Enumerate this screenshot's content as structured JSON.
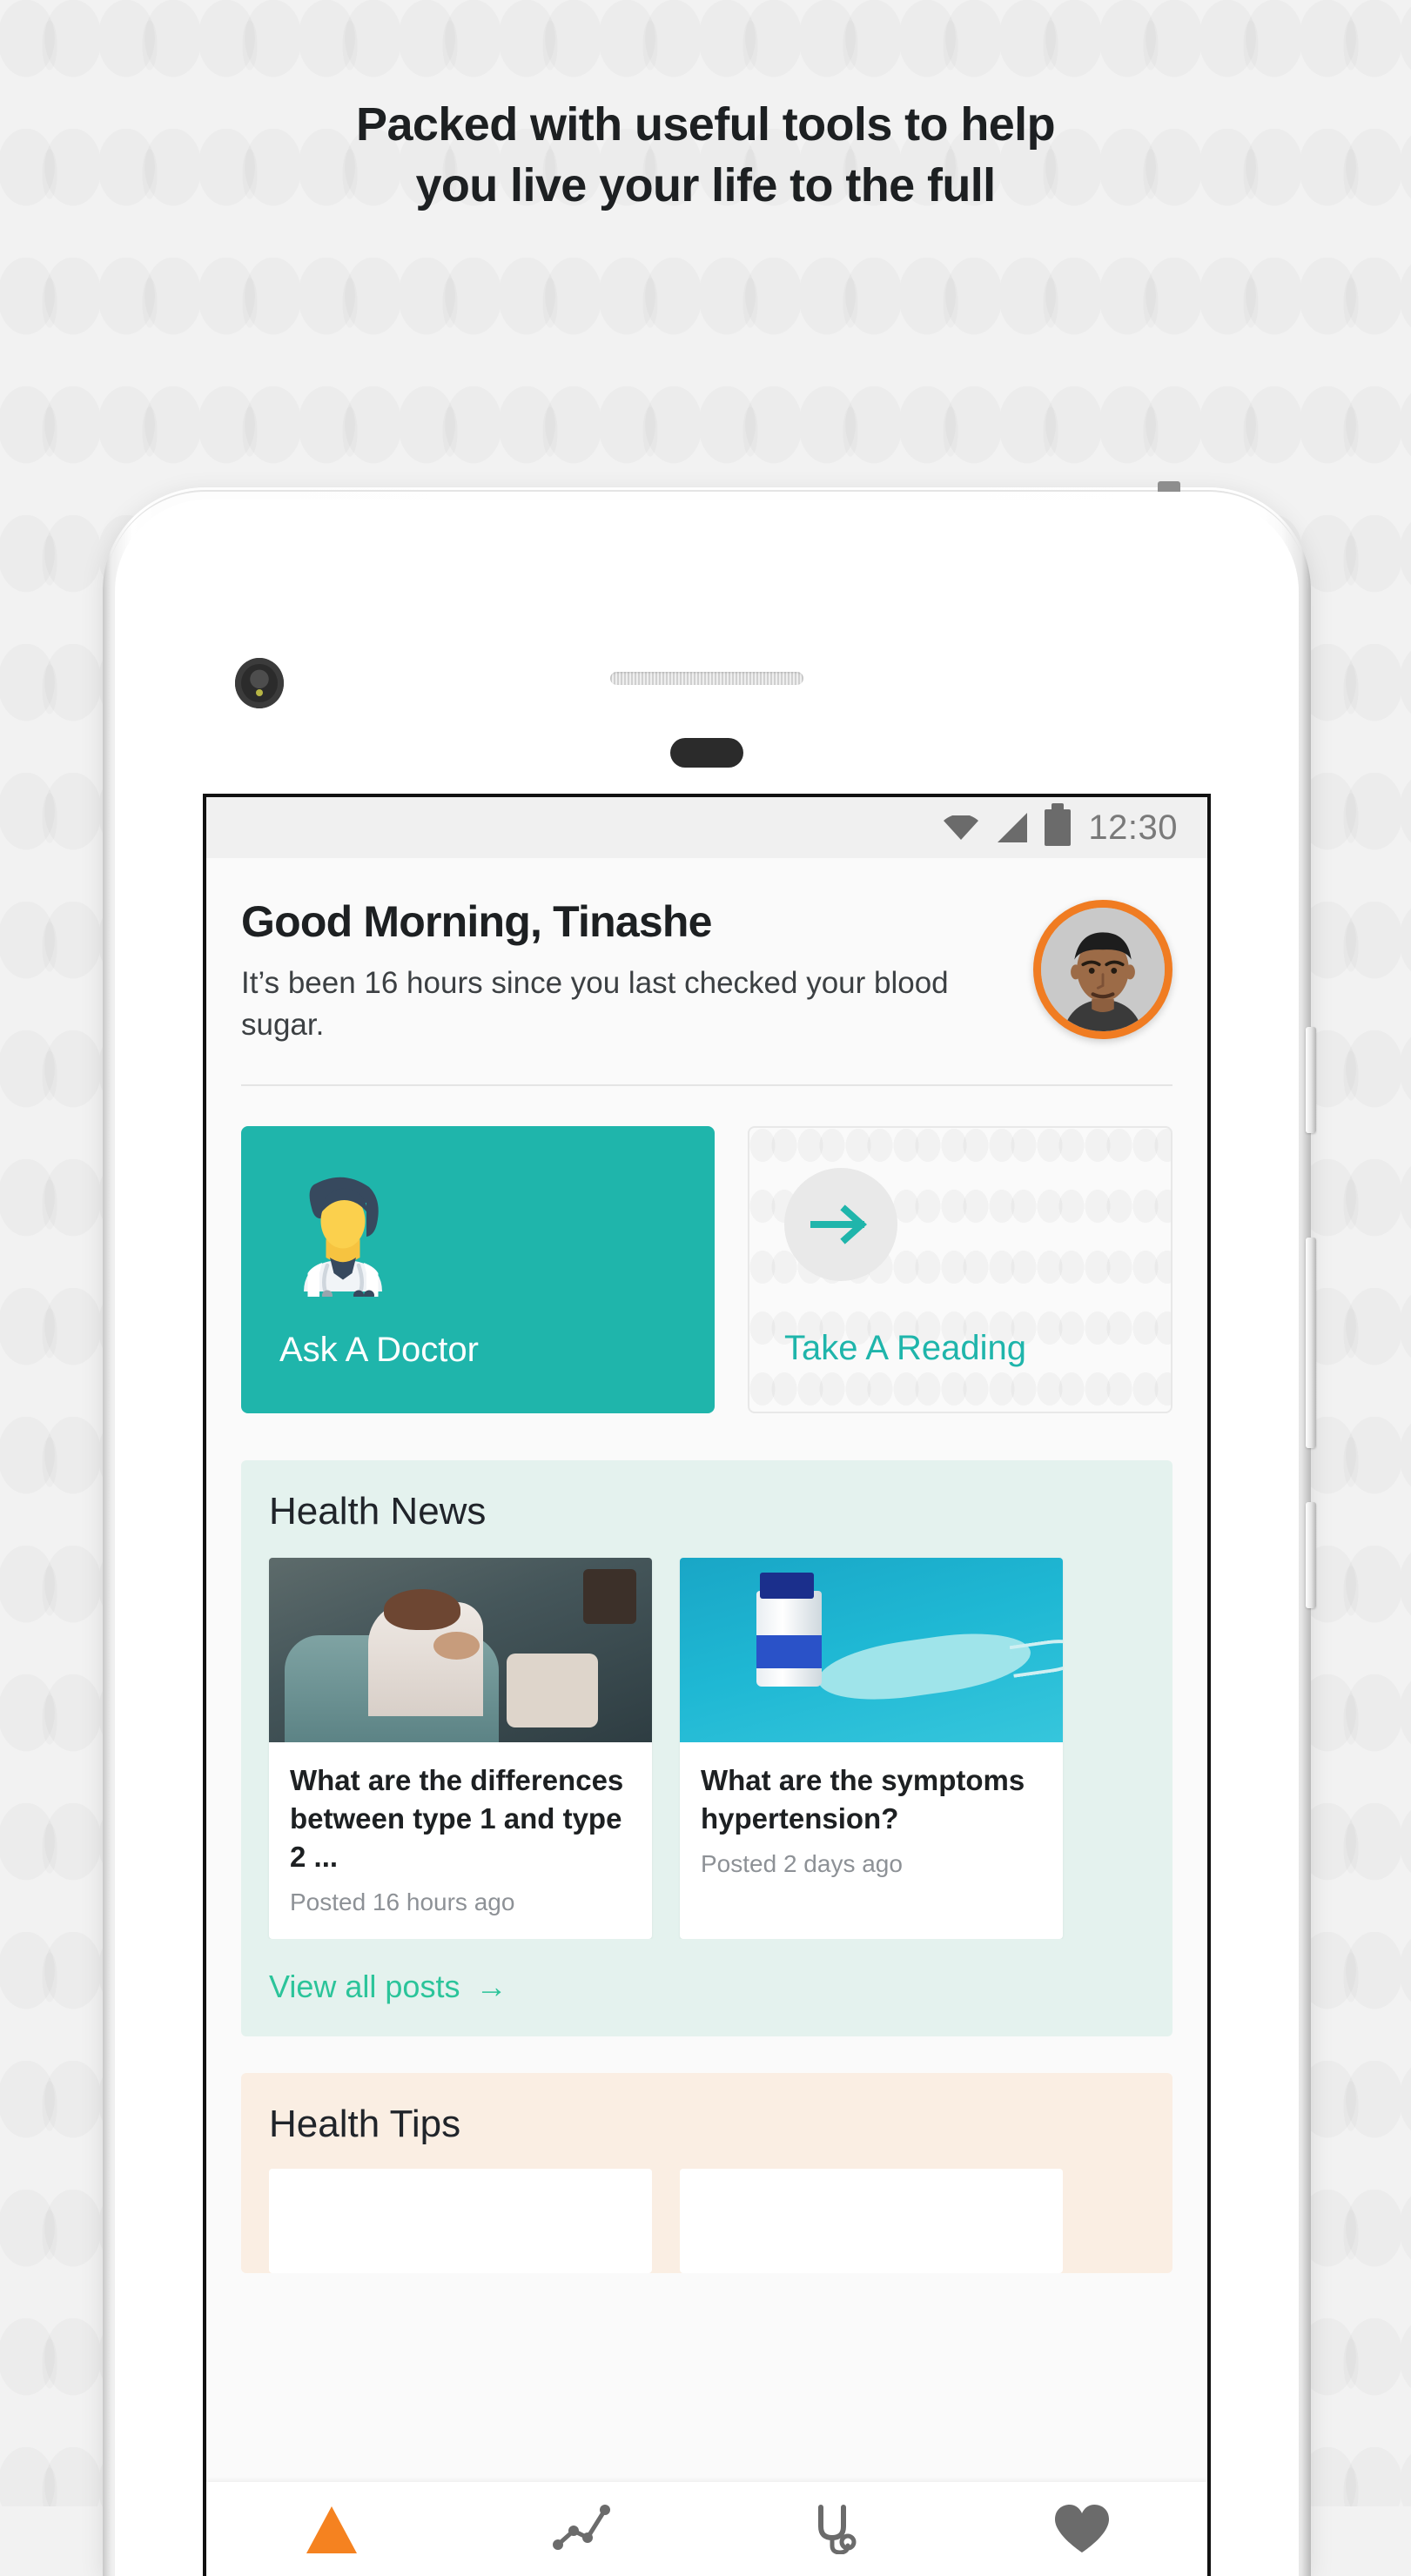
{
  "headline": {
    "line1": "Packed with useful tools to help",
    "line2": "you live your life to the full"
  },
  "device": {
    "camera_icon": "camera-icon",
    "earpiece_icon": "earpiece-speaker",
    "home_pill_icon": "home-indicator"
  },
  "statusbar": {
    "wifi_icon": "wifi-icon",
    "signal_icon": "cellular-signal-icon",
    "battery_icon": "battery-icon",
    "time": "12:30"
  },
  "greeting": {
    "title": "Good Morning, Tinashe",
    "subtitle": "It’s been 16 hours since you last checked your blood sugar.",
    "avatar_icon": "user-avatar",
    "avatar_ring_color": "#f07c22"
  },
  "actions": {
    "ask_doctor": {
      "label": "Ask A Doctor",
      "icon": "doctor-icon",
      "background_color": "#1fb5ab",
      "text_color": "#ffffff"
    },
    "take_reading": {
      "label": "Take A  Reading",
      "icon": "arrow-right-icon",
      "text_color": "#1fb5ab"
    }
  },
  "health_news": {
    "title": "Health News",
    "background_color": "#e4f2ee",
    "posts": [
      {
        "headline": "What are the differences between type 1 and type 2 ...",
        "meta": "Posted 16 hours ago",
        "thumbnail": "woman-coughing-on-sofa-photo"
      },
      {
        "headline": "What are the symptoms hypertension?",
        "meta": "Posted 2 days ago",
        "thumbnail": "medicine-bottle-and-face-mask-photo"
      }
    ],
    "view_all_label": "View all posts",
    "view_all_arrow": "→",
    "link_color": "#2bc49a"
  },
  "health_tips": {
    "title": "Health Tips",
    "background_color": "#faeee3"
  },
  "bottom_nav": {
    "items": [
      {
        "icon": "home-icon",
        "active": true,
        "color": "#f58220"
      },
      {
        "icon": "activity-chart-icon",
        "active": false,
        "color": "#6b6b6b"
      },
      {
        "icon": "stethoscope-icon",
        "active": false,
        "color": "#6b6b6b"
      },
      {
        "icon": "heart-icon",
        "active": false,
        "color": "#6b6b6b"
      }
    ]
  }
}
